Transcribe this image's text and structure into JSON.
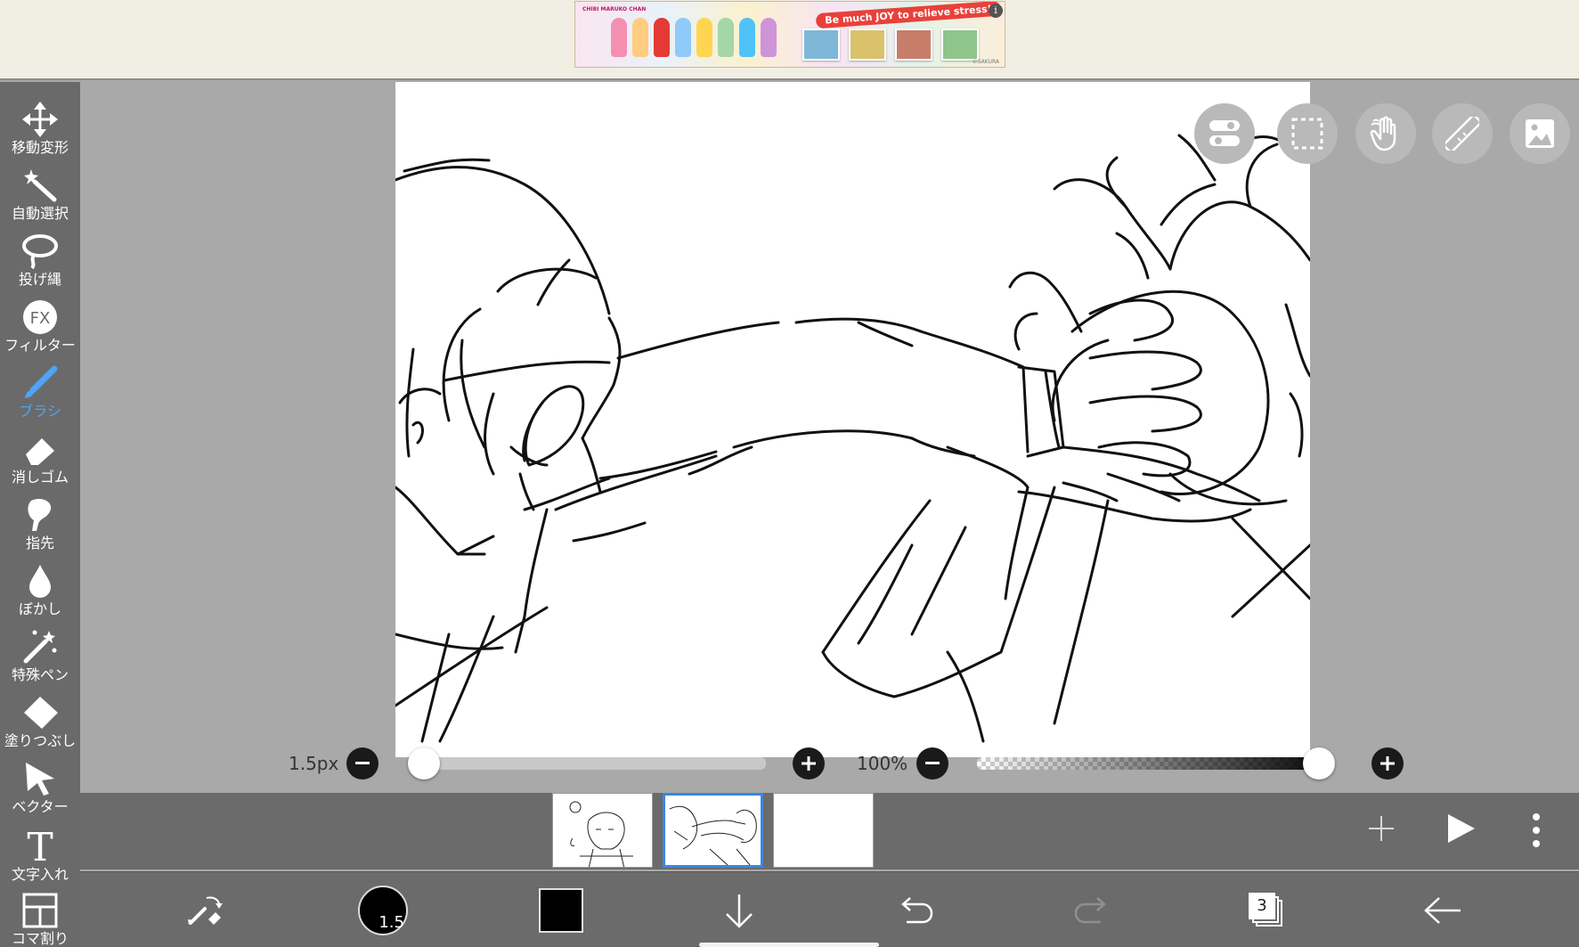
{
  "ad": {
    "title_small": "CHIBI MARUKO CHAN",
    "tagline": "Be much JOY to relieve stress!",
    "copyright": "©SAKURA",
    "info_glyph": "i"
  },
  "tools": [
    {
      "label": "移動変形",
      "icon": "move-icon",
      "active": false
    },
    {
      "label": "自動選択",
      "icon": "magic-wand-icon",
      "active": false
    },
    {
      "label": "投げ縄",
      "icon": "lasso-icon",
      "active": false
    },
    {
      "label": "フィルター",
      "icon": "fx-icon",
      "active": false
    },
    {
      "label": "ブラシ",
      "icon": "brush-icon",
      "active": true
    },
    {
      "label": "消しゴム",
      "icon": "eraser-icon",
      "active": false
    },
    {
      "label": "指先",
      "icon": "finger-icon",
      "active": false
    },
    {
      "label": "ぼかし",
      "icon": "blur-drop-icon",
      "active": false
    },
    {
      "label": "特殊ペン",
      "icon": "special-pen-icon",
      "active": false
    },
    {
      "label": "塗りつぶし",
      "icon": "fill-bucket-icon",
      "active": false
    },
    {
      "label": "ベクター",
      "icon": "vector-arrow-icon",
      "active": false
    },
    {
      "label": "文字入れ",
      "icon": "text-t-icon",
      "active": false
    },
    {
      "label": "コマ割り",
      "icon": "frame-divide-icon",
      "active": false
    }
  ],
  "fx_glyph": "FX",
  "text_glyph": "T",
  "floating_buttons": [
    "toggle-icon",
    "selection-icon",
    "hand-icon",
    "ruler-icon",
    "image-icon"
  ],
  "brush_size": {
    "label": "1.5px",
    "value": 0.0
  },
  "opacity": {
    "label": "100%",
    "value": 1.0
  },
  "frames": {
    "count": 3,
    "selected_index": 1
  },
  "frame_actions": {
    "add": "add-frame-icon",
    "play": "play-icon",
    "more": "more-vertical-icon"
  },
  "bottom_bar": {
    "brush_preview_value": "1.5",
    "color": "#000000",
    "layers_count": "3"
  },
  "colors": {
    "accent": "#4da3f5",
    "selected_frame": "#3a86e0",
    "toolbar": "#6a6a6a",
    "canvas": "#ffffff",
    "workspace": "#a9a9a9"
  }
}
